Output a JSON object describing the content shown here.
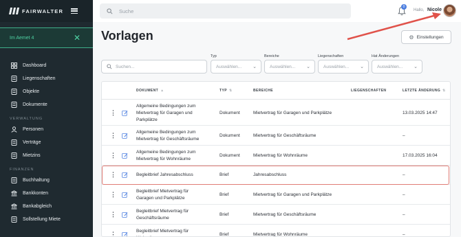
{
  "brand": {
    "name": "FAIRWALTER"
  },
  "sidebar": {
    "property": "Im Aemet 4",
    "groups": [
      {
        "title": "",
        "items": [
          {
            "label": "Dashboard",
            "icon": "dashboard-icon"
          },
          {
            "label": "Liegenschaften",
            "icon": "building-icon"
          },
          {
            "label": "Objekte",
            "icon": "object-icon"
          },
          {
            "label": "Dokumente",
            "icon": "document-icon"
          }
        ]
      },
      {
        "title": "VERWALTUNG",
        "items": [
          {
            "label": "Personen",
            "icon": "person-icon"
          },
          {
            "label": "Verträge",
            "icon": "contract-icon"
          },
          {
            "label": "Mietzins",
            "icon": "rent-icon"
          }
        ]
      },
      {
        "title": "FINANZEN",
        "items": [
          {
            "label": "Buchhaltung",
            "icon": "accounting-icon"
          },
          {
            "label": "Bankkonten",
            "icon": "bank-icon"
          },
          {
            "label": "Bankabgleich",
            "icon": "bank-reconcile-icon"
          },
          {
            "label": "Sollstellung Miete",
            "icon": "invoice-icon"
          }
        ]
      }
    ]
  },
  "topbar": {
    "search_placeholder": "Suche",
    "notification_count": "0",
    "greeting": "Hallo,",
    "user": "Nicole"
  },
  "page": {
    "title": "Vorlagen",
    "settings_label": "Einstellungen"
  },
  "filters": {
    "search_placeholder": "Suchen...",
    "selects": [
      {
        "label": "Typ",
        "placeholder": "Auswählen..."
      },
      {
        "label": "Bereiche",
        "placeholder": "Auswählen..."
      },
      {
        "label": "Liegenschaften",
        "placeholder": "Auswählen..."
      },
      {
        "label": "Hat Änderungen",
        "placeholder": "Auswählen..."
      }
    ]
  },
  "table": {
    "columns": [
      "DOKUMENT",
      "TYP",
      "BEREICHE",
      "LIEGENSCHAFTEN",
      "LETZTE ÄNDERUNG"
    ],
    "rows": [
      {
        "doc": [
          "Allgemeine Bedingungen zum",
          "Mietvertrag für Garagen und",
          "Parkplätze"
        ],
        "typ": "Dokument",
        "bereich": "Mietvertrag für Garagen und Parkplätze",
        "liegenschaften": "",
        "date": "13.03.2025 14:47"
      },
      {
        "doc": [
          "Allgemeine Bedingungen zum",
          "Mietvertrag für Geschäftsräume"
        ],
        "typ": "Dokument",
        "bereich": "Mietvertrag für Geschäftsräume",
        "liegenschaften": "",
        "date": "–"
      },
      {
        "doc": [
          "Allgemeine Bedingungen zum",
          "Mietvertrag für Wohnräume"
        ],
        "typ": "Dokument",
        "bereich": "Mietvertrag für Wohnräume",
        "liegenschaften": "",
        "date": "17.03.2025 16:04"
      },
      {
        "doc": [
          "Begleitbrief Jahresabschluss"
        ],
        "typ": "Brief",
        "bereich": "Jahresabschluss",
        "liegenschaften": "",
        "date": "–"
      },
      {
        "doc": [
          "Begleitbrief Mietvertrag für",
          "Garagen und Parkplätze"
        ],
        "typ": "Brief",
        "bereich": "Mietvertrag für Garagen und Parkplätze",
        "liegenschaften": "",
        "date": "–"
      },
      {
        "doc": [
          "Begleitbrief Mietvertrag für",
          "Geschäftsräume"
        ],
        "typ": "Brief",
        "bereich": "Mietvertrag für Geschäftsräume",
        "liegenschaften": "",
        "date": "–"
      },
      {
        "doc": [
          "Begleitbrief Mietvertrag für",
          "Wohnräume"
        ],
        "typ": "Brief",
        "bereich": "Mietvertrag für Wohnräume",
        "liegenschaften": "",
        "date": "–"
      }
    ]
  },
  "colors": {
    "accent": "#4fd3a4",
    "sidebar": "#1f2a30",
    "highlight": "#e07b74",
    "arrow": "#e0524a"
  }
}
